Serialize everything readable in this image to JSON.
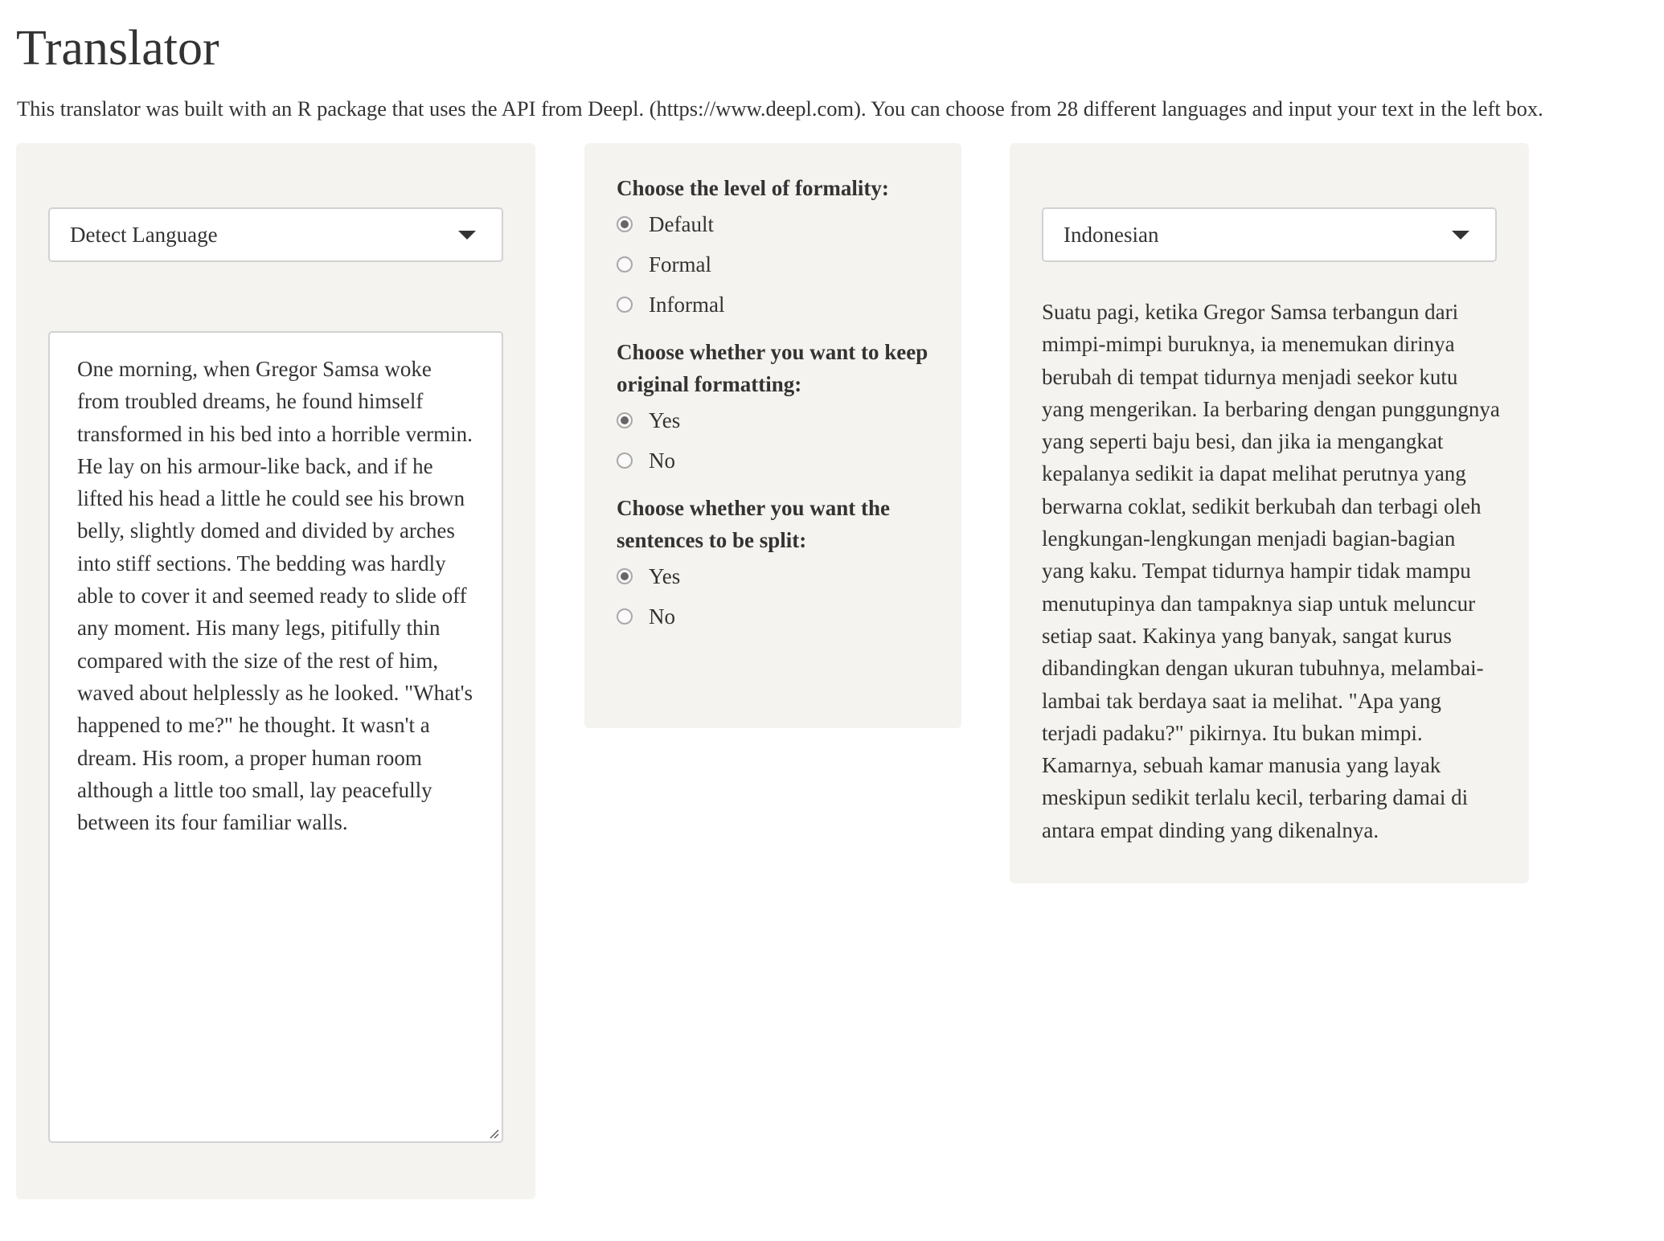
{
  "page": {
    "title": "Translator",
    "intro": "This translator was built with an R package that uses the API from Deepl. (https://www.deepl.com). You can choose from 28 different languages and input your text in the left box."
  },
  "source": {
    "language_selected": "Detect Language",
    "text": "One morning, when Gregor Samsa woke from troubled dreams, he found himself transformed in his bed into a horrible vermin. He lay on his armour-like back, and if he lifted his head a little he could see his brown belly, slightly domed and divided by arches into stiff sections. The bedding was hardly able to cover it and seemed ready to slide off any moment. His many legs, pitifully thin compared with the size of the rest of him, waved about helplessly as he looked. \"What's happened to me?\" he thought. It wasn't a dream. His room, a proper human room although a little too small, lay peacefully between its four familiar walls."
  },
  "options": {
    "formality": {
      "label": "Choose the level of formality:",
      "choices": [
        "Default",
        "Formal",
        "Informal"
      ],
      "selected": "Default"
    },
    "formatting": {
      "label": "Choose whether you want to keep original formatting:",
      "choices": [
        "Yes",
        "No"
      ],
      "selected": "Yes"
    },
    "split": {
      "label": "Choose whether you want the sentences to be split:",
      "choices": [
        "Yes",
        "No"
      ],
      "selected": "Yes"
    }
  },
  "target": {
    "language_selected": "Indonesian",
    "text": "Suatu pagi, ketika Gregor Samsa terbangun dari mimpi-mimpi buruknya, ia menemukan dirinya berubah di tempat tidurnya menjadi seekor kutu yang mengerikan. Ia berbaring dengan punggungnya yang seperti baju besi, dan jika ia mengangkat kepalanya sedikit ia dapat melihat perutnya yang berwarna coklat, sedikit berkubah dan terbagi oleh lengkungan-lengkungan menjadi bagian-bagian yang kaku. Tempat tidurnya hampir tidak mampu menutupinya dan tampaknya siap untuk meluncur setiap saat. Kakinya yang banyak, sangat kurus dibandingkan dengan ukuran tubuhnya, melambai-lambai tak berdaya saat ia melihat. \"Apa yang terjadi padaku?\" pikirnya. Itu bukan mimpi. Kamarnya, sebuah kamar manusia yang layak meskipun sedikit terlalu kecil, terbaring damai di antara empat dinding yang dikenalnya."
  },
  "colors": {
    "panel_bg": "#f5f3ef",
    "text": "#333333",
    "border": "#d2d2d2"
  },
  "icons": {
    "select_caret": "chevron-down-icon",
    "resize": "resize-grip-icon"
  }
}
